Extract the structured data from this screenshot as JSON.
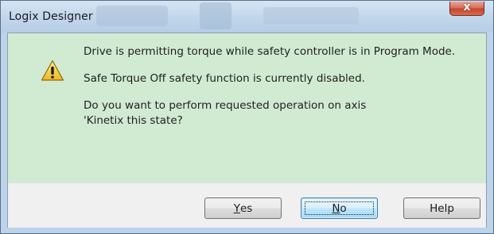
{
  "window": {
    "title": "Logix Designer",
    "close_glyph": "x"
  },
  "icon": {
    "name": "warning-icon"
  },
  "message": {
    "line1": "Drive is permitting torque while safety controller is in Program Mode.",
    "line2": "Safe Torque Off safety function is currently disabled.",
    "line3": "Do you want to perform requested operation on axis",
    "line4": "'Kinetix this state?"
  },
  "buttons": {
    "yes": {
      "mnemonic": "Y",
      "rest": "es"
    },
    "no": {
      "mnemonic": "N",
      "rest": "o"
    },
    "help": {
      "label": "Help"
    }
  },
  "colors": {
    "content_bg": "#d1ebd2",
    "footer_bg": "#f0f0f0",
    "frame": "#bcd3ea",
    "close": "#c7442e"
  }
}
